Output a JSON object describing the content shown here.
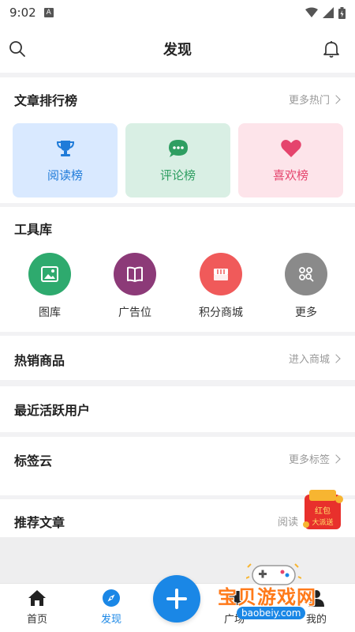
{
  "status_bar": {
    "time": "9:02",
    "notif_icon": "A"
  },
  "header": {
    "title": "发现",
    "search_icon": "search-icon",
    "bell_icon": "bell-icon"
  },
  "ranking": {
    "title": "文章排行榜",
    "more": "更多热门",
    "tiles": [
      {
        "label": "阅读榜",
        "icon": "trophy-icon",
        "color": "#1f7bd9"
      },
      {
        "label": "评论榜",
        "icon": "chat-bubble-icon",
        "color": "#2e9e61"
      },
      {
        "label": "喜欢榜",
        "icon": "heart-icon",
        "color": "#e5446d"
      }
    ]
  },
  "tools": {
    "title": "工具库",
    "items": [
      {
        "label": "图库",
        "icon": "image-icon",
        "color": "#2eaa6e"
      },
      {
        "label": "广告位",
        "icon": "book-icon",
        "color": "#8c3a78"
      },
      {
        "label": "积分商城",
        "icon": "store-icon",
        "color": "#f05a5a"
      },
      {
        "label": "更多",
        "icon": "grid-search-icon",
        "color": "#8a8a8a"
      }
    ]
  },
  "hot_goods": {
    "title": "热销商品",
    "more": "进入商城"
  },
  "active_users": {
    "title": "最近活跃用户"
  },
  "tag_cloud": {
    "title": "标签云",
    "more": "更多标签"
  },
  "recommended": {
    "title": "推荐文章",
    "more": "阅读"
  },
  "tabbar": {
    "items": [
      {
        "label": "首页",
        "icon": "home-icon"
      },
      {
        "label": "发现",
        "icon": "compass-icon",
        "active": true
      },
      {
        "label": "广场",
        "icon": "square-icon"
      },
      {
        "label": "我的",
        "icon": "user-icon"
      }
    ],
    "fab_icon": "plus-icon",
    "accent": "#1a87e6"
  },
  "overlay": {
    "hongbao_text": "红包大派送",
    "watermark_text": "宝贝游戏网",
    "watermark_url": "baobeiy.com"
  }
}
